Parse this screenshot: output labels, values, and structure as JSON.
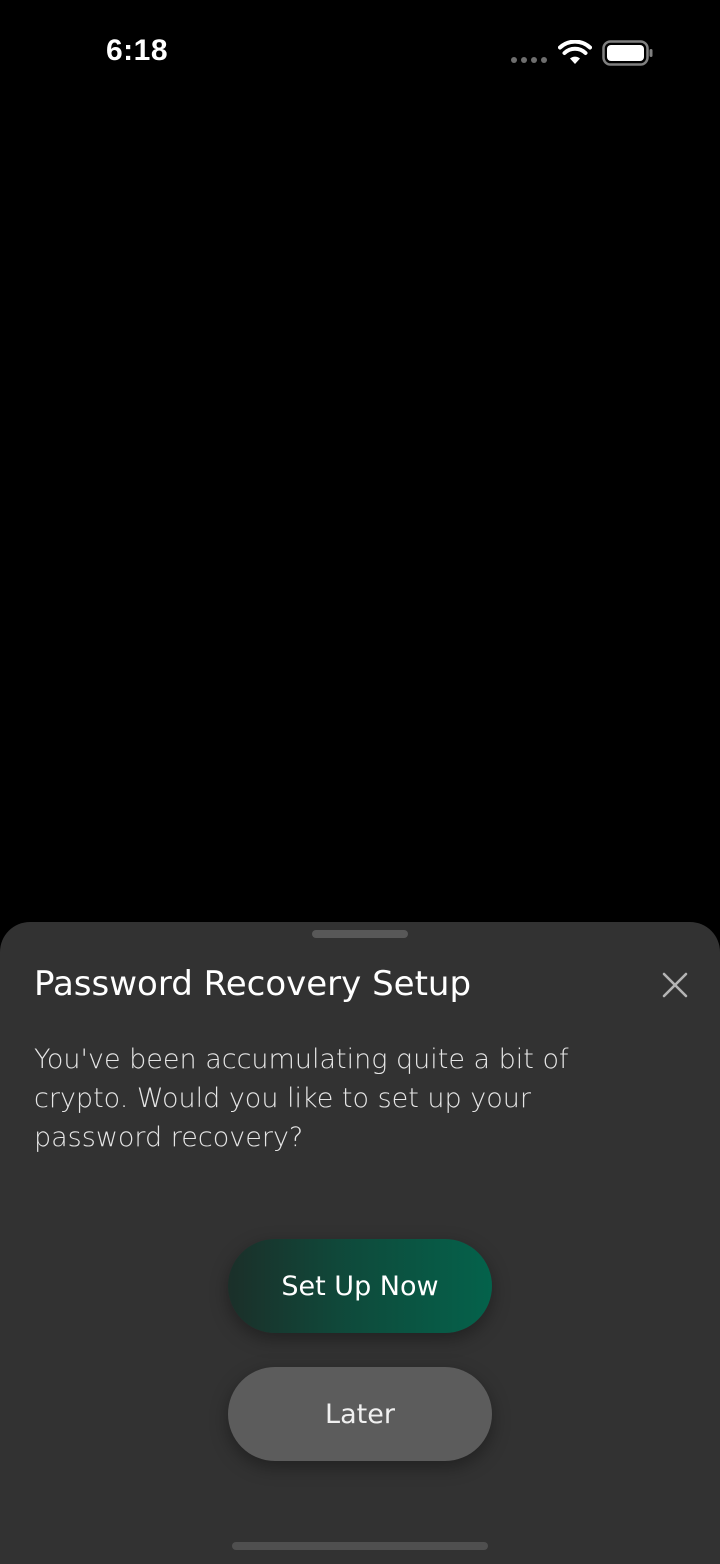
{
  "status_bar": {
    "time": "6:18",
    "signal_icon": "signal-dots-icon",
    "wifi_icon": "wifi-icon",
    "battery_icon": "battery-icon"
  },
  "sheet": {
    "title": "Password Recovery Setup",
    "close_icon": "close-icon",
    "message": "You've been accumulating quite a bit of crypto. Would you like to set up your password recovery?",
    "primary_button_label": "Set Up Now",
    "secondary_button_label": "Later"
  },
  "colors": {
    "background": "#000000",
    "sheet_background": "#323232",
    "primary_button_accent": "#04624b",
    "secondary_button": "#5c5c5c",
    "text": "#ffffff"
  }
}
